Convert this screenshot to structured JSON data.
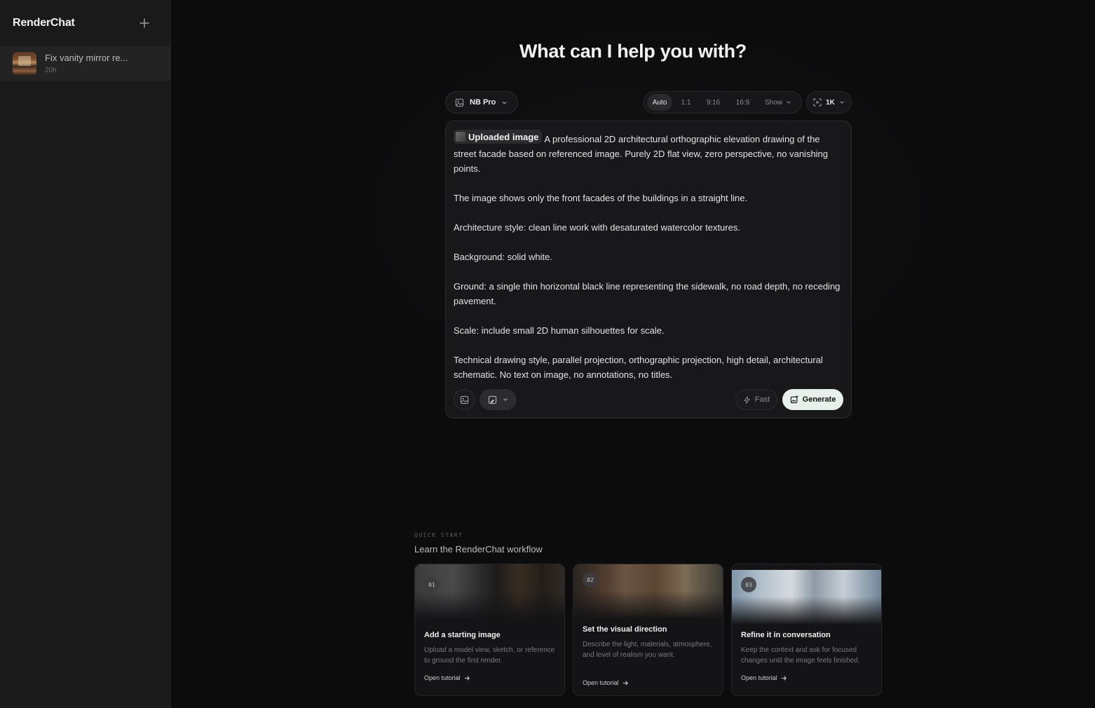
{
  "sidebar": {
    "brand": "RenderChat",
    "items": [
      {
        "title": "Fix vanity mirror re...",
        "time": "20h"
      }
    ]
  },
  "main": {
    "headline": "What can I help you with?",
    "model": {
      "label": "NB Pro"
    },
    "ratios": [
      "Auto",
      "1:1",
      "9:16",
      "16:9",
      "Show"
    ],
    "active_ratio": "Auto",
    "resolution": "1K",
    "prompt": {
      "chip_label": "Uploaded image",
      "paragraphs": [
        "A professional 2D architectural orthographic elevation drawing of the street facade based on referenced image. Purely 2D flat view, zero perspective, no vanishing points.",
        "The image shows only the front facades of the buildings in a straight line.",
        "Architecture style: clean line work with desaturated watercolor textures.",
        "Background: solid white.",
        "Ground: a single thin horizontal black line representing the sidewalk, no road depth, no receding pavement.",
        "Scale: include small 2D human silhouettes for scale.",
        "Technical drawing style, parallel projection, orthographic projection, high detail, architectural schematic. No text on image, no annotations, no titles."
      ]
    },
    "fast_label": "Fast",
    "generate_label": "Generate"
  },
  "quick_start": {
    "kicker": "QUICK START",
    "title": "Learn the RenderChat workflow",
    "cards": [
      {
        "num": "01",
        "title": "Add a starting image",
        "desc": "Upload a model view, sketch, or reference to ground the first render.",
        "link": "Open tutorial"
      },
      {
        "num": "02",
        "title": "Set the visual direction",
        "desc": "Describe the light, materials, atmosphere, and level of realism you want.",
        "link": "Open tutorial"
      },
      {
        "num": "03",
        "title": "Refine it in conversation",
        "desc": "Keep the context and ask for focused changes until the image feels finished.",
        "link": "Open tutorial"
      }
    ]
  }
}
